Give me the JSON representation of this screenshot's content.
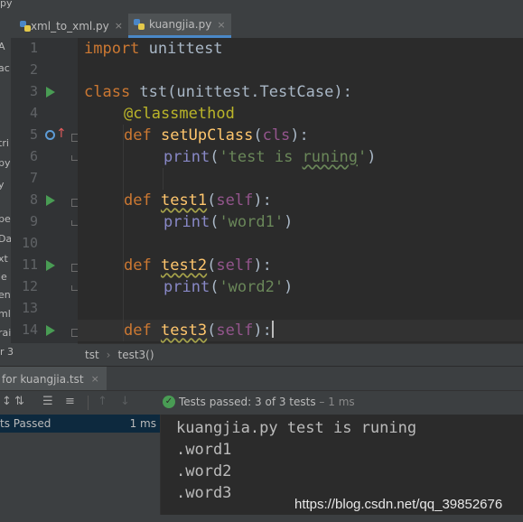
{
  "top_strip": {
    "text": "py"
  },
  "tabs": [
    {
      "label": "xml_to_xml.py",
      "close": "×",
      "active": false
    },
    {
      "label": "kuangjia.py",
      "close": "×",
      "active": true
    }
  ],
  "left_strip_fragments": [
    "A",
    "ac",
    "tri",
    "py",
    "y",
    "pe",
    "Da",
    "xt",
    "ie",
    "en",
    "ml",
    "rai",
    "r 3"
  ],
  "line_numbers": [
    "1",
    "2",
    "3",
    "4",
    "5",
    "6",
    "7",
    "8",
    "9",
    "10",
    "11",
    "12",
    "13",
    "14"
  ],
  "code": {
    "l1_kw": "import",
    "l1_rest": " unittest",
    "l3_kw": "class",
    "l3_rest": " tst(unittest.TestCase):",
    "l4_dec": "@classmethod",
    "l5_kw": "def",
    "l5_fn": "setUpClass",
    "l5_p1": "(",
    "l5_arg": "cls",
    "l5_p2": "):",
    "l6_bi": "print",
    "l6_p1": "(",
    "l6_s1": "'test is ",
    "l6_s2": "runing",
    "l6_s3": "'",
    "l6_p2": ")",
    "l8_kw": "def",
    "l8_fn": "test1",
    "l8_p1": "(",
    "l8_arg": "self",
    "l8_p2": "):",
    "l9_bi": "print",
    "l9_p1": "(",
    "l9_str": "'word1'",
    "l9_p2": ")",
    "l11_kw": "def",
    "l11_fn": "test2",
    "l11_p1": "(",
    "l11_arg": "self",
    "l11_p2": "):",
    "l12_bi": "print",
    "l12_p1": "(",
    "l12_str": "'word2'",
    "l12_p2": ")",
    "l14_kw": "def",
    "l14_fn": "test3",
    "l14_p1": "(",
    "l14_arg": "self",
    "l14_p2": "):"
  },
  "breadcrumb": {
    "left_fragment": "r 3",
    "class": "tst",
    "sep": "›",
    "method": "test3()"
  },
  "run_tab": {
    "label": "for kuangjia.tst",
    "close": "×"
  },
  "toolbar": {
    "sort_alpha": "↕",
    "sort_dur": "⇅",
    "expand": "☰",
    "collapse": "≡",
    "prev": "↑",
    "next": "↓",
    "check": "✓",
    "status_label": "Tests passed: ",
    "status_count": "3 of 3 tests",
    "status_time": " – 1 ms"
  },
  "tree": {
    "label": "ts Passed",
    "time": "1 ms"
  },
  "console": [
    "kuangjia.py test is runing",
    ".word1",
    ".word2",
    ".word3"
  ],
  "watermark": "https://blog.csdn.net/qq_39852676",
  "colors": {
    "keyword": "#cc7832",
    "function": "#ffc66d",
    "string": "#6a8759",
    "self": "#94558d",
    "builtin": "#8888c6",
    "decorator": "#bbb529",
    "run": "#499c54"
  }
}
